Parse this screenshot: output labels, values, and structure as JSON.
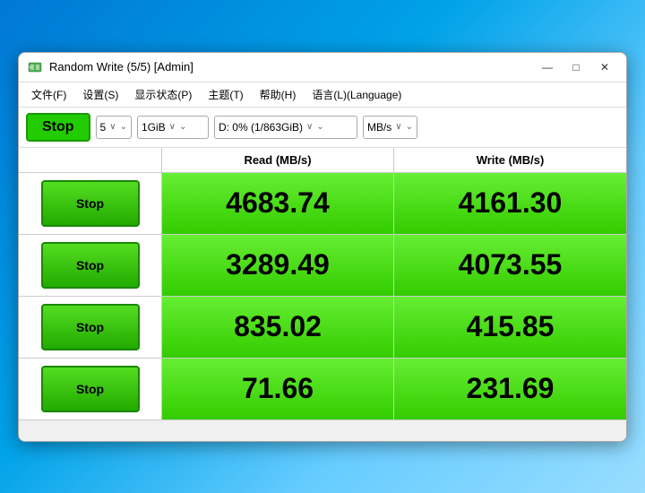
{
  "window": {
    "title": "Random Write (5/5) [Admin]",
    "icon": "disk-icon"
  },
  "menu": {
    "items": [
      {
        "label": "文件(F)"
      },
      {
        "label": "设置(S)"
      },
      {
        "label": "显示状态(P)"
      },
      {
        "label": "主题(T)"
      },
      {
        "label": "帮助(H)"
      },
      {
        "label": "语言(L)(Language)"
      }
    ]
  },
  "toolbar": {
    "main_stop_label": "Stop",
    "count_value": "5",
    "size_value": "1GiB",
    "drive_value": "D: 0% (1/863GiB)",
    "unit_value": "MB/s"
  },
  "table": {
    "headers": [
      "",
      "Read (MB/s)",
      "Write (MB/s)"
    ],
    "rows": [
      {
        "stop_label": "Stop",
        "read": "4683.74",
        "write": "4161.30"
      },
      {
        "stop_label": "Stop",
        "read": "3289.49",
        "write": "4073.55"
      },
      {
        "stop_label": "Stop",
        "read": "835.02",
        "write": "415.85"
      },
      {
        "stop_label": "Stop",
        "read": "71.66",
        "write": "231.69"
      }
    ]
  },
  "status_bar": {
    "text": ""
  },
  "window_controls": {
    "minimize": "—",
    "maximize": "□",
    "close": "✕"
  }
}
